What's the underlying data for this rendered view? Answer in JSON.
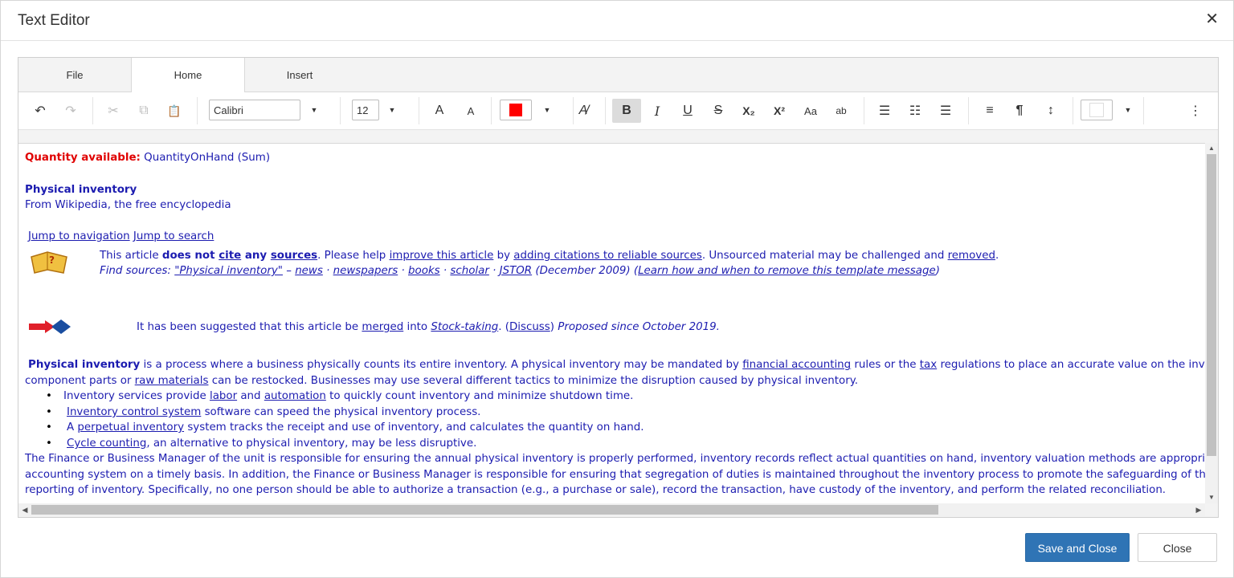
{
  "dialog": {
    "title": "Text Editor"
  },
  "tabs": [
    {
      "label": "File"
    },
    {
      "label": "Home"
    },
    {
      "label": "Insert"
    }
  ],
  "toolbar": {
    "font_name": "Calibri",
    "font_size": "12",
    "font_color": "#ff0000",
    "background_color": "#ffffff",
    "icons": {
      "undo": "↶",
      "redo": "↷",
      "cut": "✂",
      "copy": "⧉",
      "paste": "📋",
      "grow_font": "A",
      "shrink_font": "A",
      "clear_format": "A̸",
      "bold": "B",
      "italic": "I",
      "underline": "U",
      "strike": "S",
      "subscript": "X₂",
      "superscript": "X²",
      "change_case": "Aa",
      "spellcheck": "ab",
      "bullets": "☰",
      "numbering": "☷",
      "multilevel": "☰",
      "align": "≡",
      "paragraph": "¶",
      "line_spacing": "↕",
      "more": "⋮"
    }
  },
  "document": {
    "qty_label": "Quantity available:",
    "qty_value": "QuantityOnHand (Sum)",
    "heading": "Physical inventory",
    "subheading": "From Wikipedia, the free encyclopedia",
    "nav_link": "Jump to navigation",
    "search_link": "Jump to search",
    "notice": {
      "t1": "This article ",
      "t2": "does not ",
      "t3": "cite",
      "t4": " any ",
      "t5": "sources",
      "t6": ". Please help ",
      "t7": "improve this article",
      "t8": " by ",
      "t9": "adding citations to reliable sources",
      "t10": ". Unsourced material may be challenged and ",
      "t11": "removed",
      "t12": "."
    },
    "find": {
      "f1": "Find sources: ",
      "f2": "\"Physical inventory\"",
      "f3": " – ",
      "f4": "news",
      "f5": " · ",
      "f6": "newspapers",
      "f7": "books",
      "f8": "scholar",
      "f9": "JSTOR",
      "f10": "  (December 2009) (",
      "f11": "Learn how and when to remove this template message",
      "f12": ")"
    },
    "merge": {
      "m1": "It has been suggested that this article be ",
      "m2": "merged",
      "m3": " into ",
      "m4": "Stock-taking",
      "m5": ". (",
      "m6": "Discuss",
      "m7": ") ",
      "m8": "Proposed since October 2019."
    },
    "para1": {
      "p1": "Physical inventory",
      "p2": " is a process where a business physically counts its entire inventory.  A physical inventory may be mandated by ",
      "p3": "financial accounting",
      "p4": " rules or the ",
      "p5": "tax",
      "p6": " regulations to place an accurate value on the inventory, or the business may need to count inventory so",
      "p7": "component parts or ",
      "p8": "raw materials",
      "p9": " can be restocked.  Businesses may use several different tactics to minimize the disruption caused by physical inventory."
    },
    "bullets": {
      "b1a": "Inventory services provide ",
      "b1b": "labor",
      "b1c": " and ",
      "b1d": "automation",
      "b1e": " to quickly count inventory and minimize shutdown time.",
      "b2a": "Inventory control system",
      "b2b": " software can speed the physical inventory process.",
      "b3a": "A ",
      "b3b": "perpetual inventory",
      "b3c": " system tracks the receipt and use of inventory, and calculates the quantity on hand.",
      "b4a": "Cycle counting",
      "b4b": ", an alternative to physical inventory, may be less disruptive."
    },
    "para2": {
      "l1": " The Finance or Business Manager of the unit is responsible for ensuring the annual physical inventory is properly performed, inventory records reflect actual quantities on hand, inventory valuation methods are appropriate, and",
      "l2": "accounting system on a timely basis. In addition, the Finance or Business Manager is responsible for ensuring that segregation of duties is maintained throughout the inventory process to promote the safeguarding of the assets an",
      "l3": "reporting of inventory. Specifically, no one person should be able to authorize a transaction (e.g., a purchase or sale), record the transaction, have custody of the inventory, and perform the related reconciliation."
    }
  },
  "buttons": {
    "save_close": "Save and Close",
    "close": "Close"
  }
}
